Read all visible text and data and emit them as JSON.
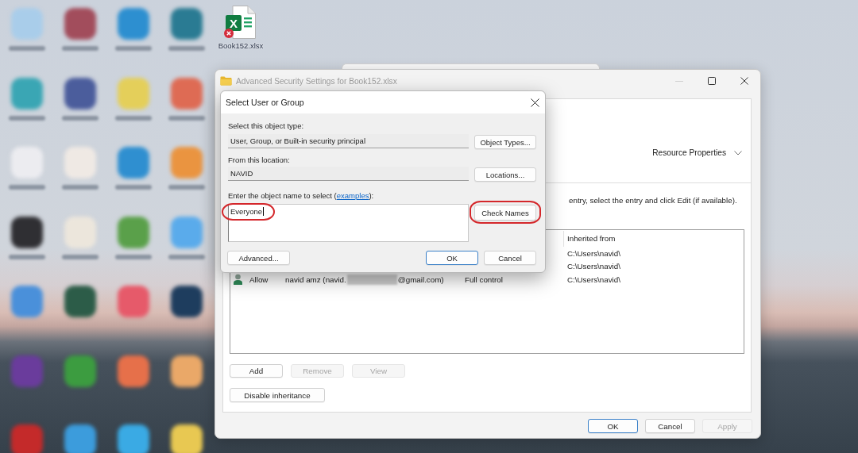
{
  "desktop": {
    "icons": [
      {
        "color": "#a9cdea",
        "blurred_label": true
      },
      {
        "color": "#a24d5c",
        "blurred_label": true
      },
      {
        "color": "#2d8fd0",
        "blurred_label": true
      },
      {
        "color": "#2a7b93",
        "blurred_label": true
      },
      {
        "color": "#3aa6b4",
        "blurred_label": true
      },
      {
        "color": "#4b5d9c",
        "blurred_label": true
      },
      {
        "color": "#e4cf5a",
        "blurred_label": true
      },
      {
        "color": "#de6b54",
        "blurred_label": true
      },
      {
        "color": "#ececf0",
        "blurred_label": true
      },
      {
        "color": "#efe9e4",
        "blurred_label": true
      },
      {
        "color": "#2f8fd0",
        "blurred_label": true
      },
      {
        "color": "#ea9440",
        "blurred_label": true
      },
      {
        "color": "#2f2f33",
        "blurred_label": true
      },
      {
        "color": "#ece6dc",
        "blurred_label": true
      },
      {
        "color": "#5aa04a",
        "blurred_label": true
      },
      {
        "color": "#5aabeb",
        "blurred_label": true
      },
      {
        "color": "#4a90da",
        "blurred_label": false
      },
      {
        "color": "#2c5c48",
        "blurred_label": false
      },
      {
        "color": "#e65a6a",
        "blurred_label": false
      },
      {
        "color": "#1e3d5e",
        "blurred_label": false
      },
      {
        "color": "#6a3c9c",
        "blurred_label": false
      },
      {
        "color": "#3c9c40",
        "blurred_label": false
      },
      {
        "color": "#e6704a",
        "blurred_label": false
      },
      {
        "color": "#eaa868",
        "blurred_label": false
      },
      {
        "color": "#c42a2a",
        "blurred_label": false
      },
      {
        "color": "#3c9cdc",
        "blurred_label": false
      },
      {
        "color": "#3aaae4",
        "blurred_label": false
      },
      {
        "color": "#e8c852",
        "blurred_label": false
      }
    ],
    "file": {
      "logo_letter": "X",
      "label": "Book152.xlsx",
      "sync_error": true
    }
  },
  "window": {
    "title": "Advanced Security Settings for Book152.xlsx",
    "active": false,
    "controls": [
      {
        "kind": "minimize",
        "disabled": true
      },
      {
        "kind": "maximize",
        "disabled": false
      },
      {
        "kind": "close",
        "disabled": false
      }
    ]
  },
  "resource_properties": {
    "label": "Resource Properties",
    "expanded": false
  },
  "instruction": "entry, select the entry and click Edit (if available).",
  "permission_list": {
    "columns": [
      "Inherited from"
    ],
    "rows": [
      {
        "inherited_from": "C:\\Users\\navid\\"
      },
      {
        "inherited_from": "C:\\Users\\navid\\"
      },
      {
        "type": "Allow",
        "principal_start": "navid amz (navid.",
        "principal_redacted": true,
        "principal_end": "@gmail.com)",
        "access": "Full control",
        "inherited_from": "C:\\Users\\navid\\"
      }
    ]
  },
  "list_buttons": [
    {
      "label": "Add",
      "disabled": false
    },
    {
      "label": "Remove",
      "disabled": true
    },
    {
      "label": "View",
      "disabled": true
    }
  ],
  "disable_inheritance": {
    "label": "Disable inheritance"
  },
  "footer_buttons": [
    {
      "label": "OK",
      "default": true,
      "disabled": false
    },
    {
      "label": "Cancel",
      "default": false,
      "disabled": false
    },
    {
      "label": "Apply",
      "default": false,
      "disabled": true
    }
  ],
  "dialog": {
    "title": "Select User or Group",
    "object_type": {
      "label": "Select this object type:",
      "value": "User, Group, or Built-in security principal",
      "button": "Object Types..."
    },
    "location": {
      "label": "From this location:",
      "value": "NAVID",
      "button": "Locations..."
    },
    "object_name": {
      "label_before": "Enter the object name to select (",
      "link": "examples",
      "label_after": "):",
      "value": "Everyone",
      "focused": true,
      "highlighted": true
    },
    "check_names": {
      "label": "Check Names",
      "highlighted": true
    },
    "buttons": [
      {
        "label": "Advanced...",
        "default": false
      },
      {
        "label": "OK",
        "default": true
      },
      {
        "label": "Cancel",
        "default": false
      }
    ]
  }
}
